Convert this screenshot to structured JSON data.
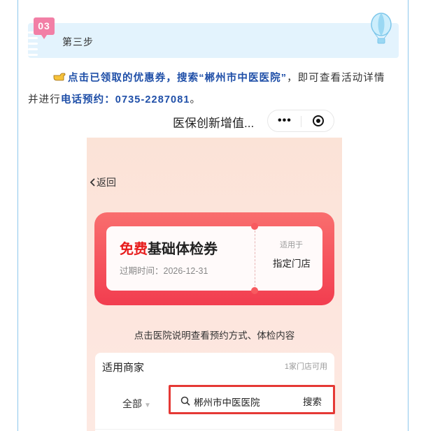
{
  "step": {
    "number": "03",
    "label": "第三步"
  },
  "instruction": {
    "line1_highlight": "点击已领取的优惠券，搜索“郴州市中医医院”",
    "line1_rest": "，即可查看活动详情",
    "line2_prefix": "并进行",
    "line2_highlight": "电话预约：0735-2287081",
    "line2_end": "。"
  },
  "miniapp": {
    "title": "医保创新增值...",
    "menu_dots": "•••",
    "back_label": "返回",
    "coupon": {
      "free_label": "免费",
      "name": "基础体检券",
      "expiry": "过期时间：2026-12-31",
      "scope_label": "适用于",
      "scope_value": "指定门店"
    },
    "hint": "点击医院说明查看预约方式、体检内容",
    "merchants": {
      "title": "适用商家",
      "count": "1家门店可用",
      "filter": "全部",
      "search_value": "郴州市中医医院",
      "search_button": "搜索"
    }
  },
  "colors": {
    "accent_blue": "#1f4fa8",
    "badge_pink": "#f27fa6",
    "coupon_red": "#f23d4f",
    "highlight_border": "#e53935"
  }
}
